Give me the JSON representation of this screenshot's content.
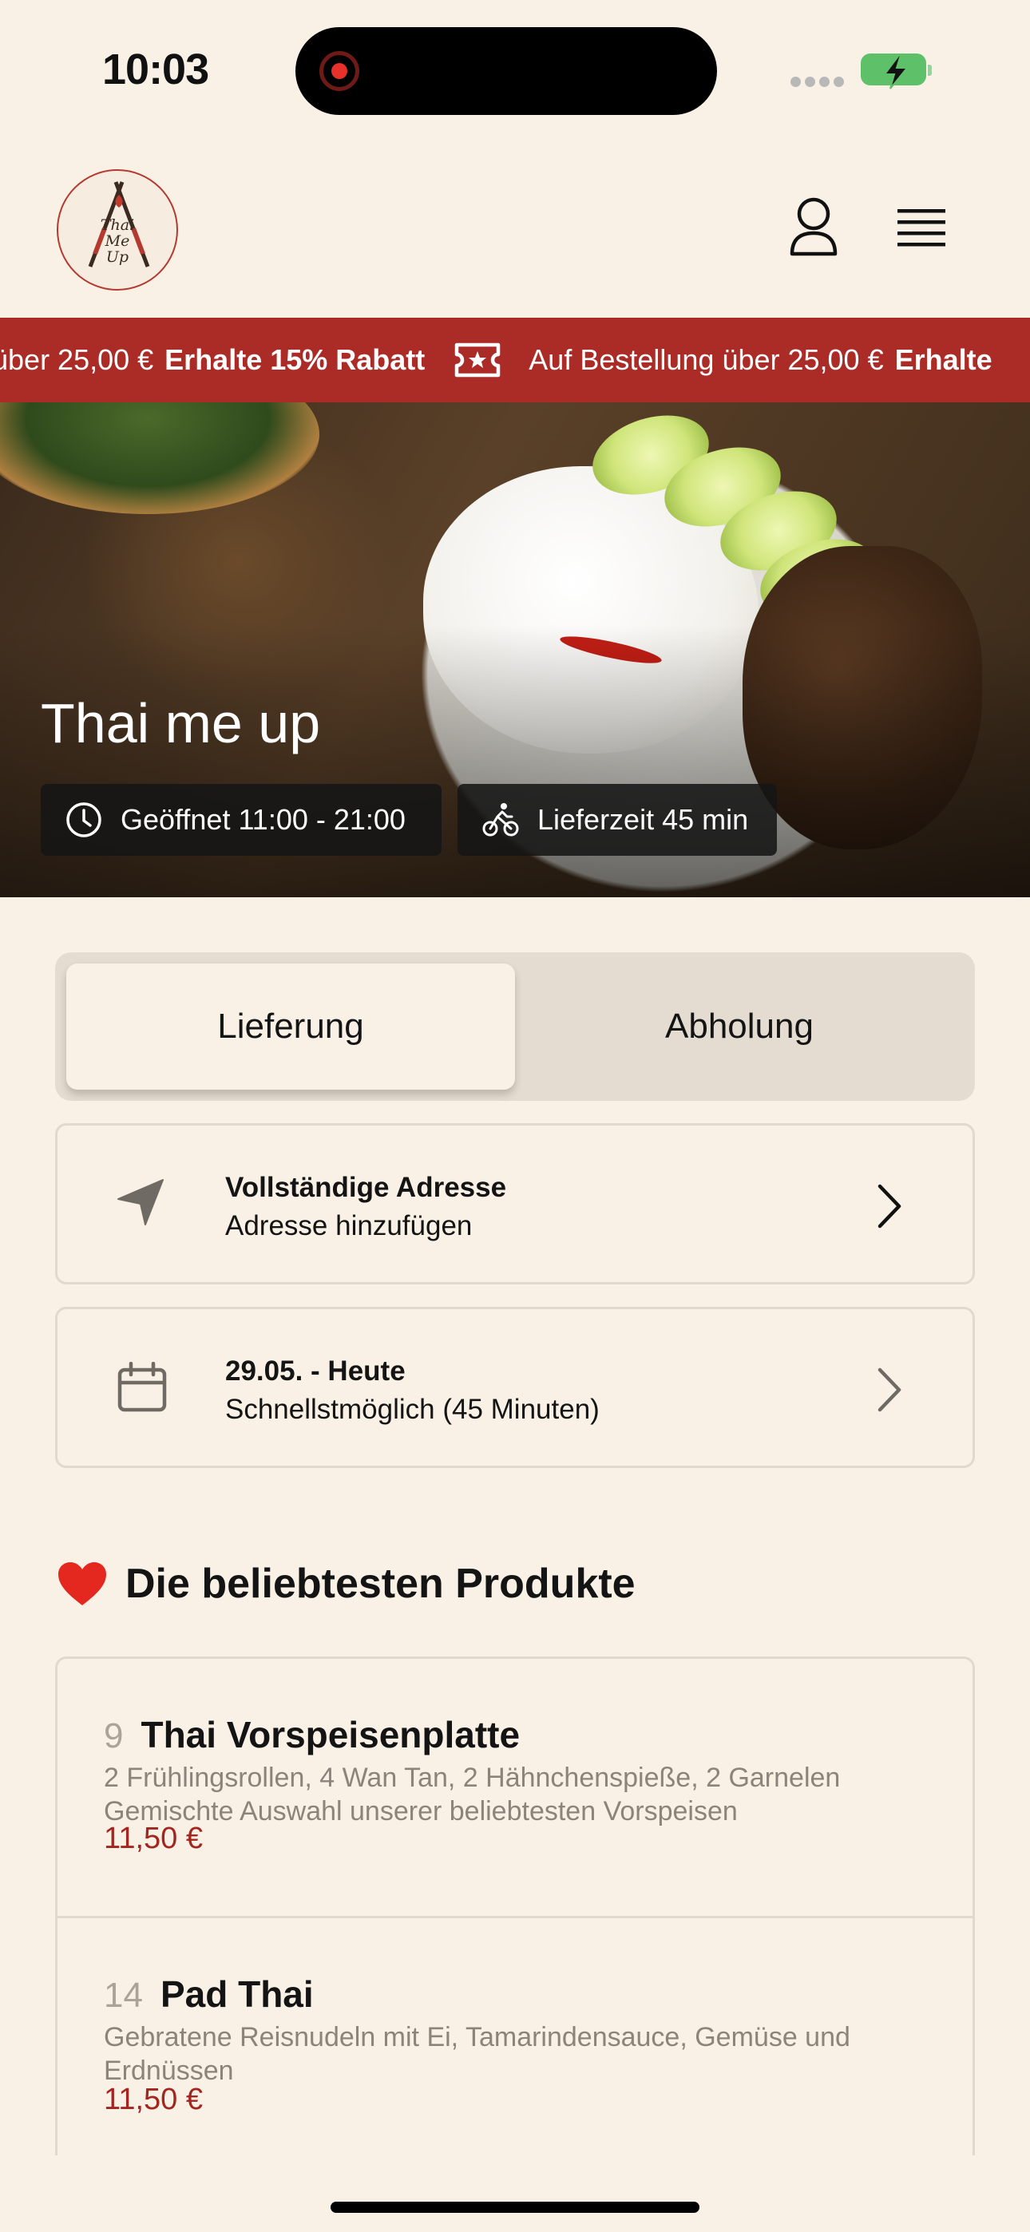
{
  "status_bar": {
    "time": "10:03"
  },
  "header": {
    "logo_text": [
      "Thai",
      "Me",
      "Up"
    ]
  },
  "promo": {
    "items": [
      {
        "text": "über 25,00 €",
        "bold": "Erhalte 15% Rabatt"
      },
      {
        "text": "Auf Bestellung über 25,00 €",
        "bold": "Erhalte"
      }
    ]
  },
  "hero": {
    "title": "Thai me up",
    "opening_hours": "Geöffnet 11:00 - 21:00",
    "delivery_time": "Lieferzeit 45 min"
  },
  "order_mode": {
    "options": [
      "Lieferung",
      "Abholung"
    ],
    "selected": "Lieferung"
  },
  "address": {
    "title": "Vollständige Adresse",
    "subtitle": "Adresse hinzufügen"
  },
  "schedule": {
    "title": "29.05. - Heute",
    "subtitle": "Schnellstmöglich (45 Minuten)"
  },
  "popular": {
    "title": "Die beliebtesten Produkte",
    "products": [
      {
        "number": "9",
        "name": "Thai Vorspeisenplatte",
        "desc_lines": [
          "2 Frühlingsrollen, 4 Wan Tan, 2 Hähnchenspieße, 2 Garnelen",
          "Gemischte Auswahl unserer beliebtesten Vorspeisen"
        ],
        "price": "11,50 €"
      },
      {
        "number": "14",
        "name": "Pad Thai",
        "desc_lines": [
          "Gebratene Reisnudeln mit Ei, Tamarindensauce, Gemüse und",
          "Erdnüssen"
        ],
        "price": "11,50 €"
      }
    ]
  },
  "colors": {
    "background": "#f9f1e6",
    "brand_red": "#ab2c27",
    "price_red": "#a2261f",
    "muted_text": "#8a847b",
    "border": "#e2d9cc"
  },
  "icons": [
    "record-icon",
    "battery-charging-icon",
    "user-icon",
    "hamburger-menu-icon",
    "ticket-icon",
    "clock-icon",
    "bike-icon",
    "location-arrow-icon",
    "calendar-icon",
    "chevron-right-icon",
    "heart-icon"
  ]
}
